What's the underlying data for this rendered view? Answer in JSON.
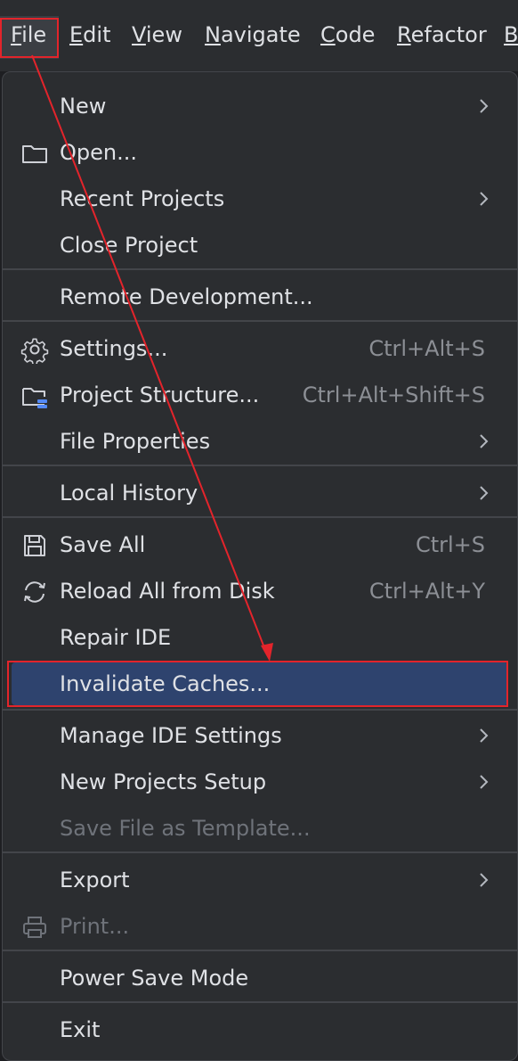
{
  "menubar": {
    "items": [
      {
        "mnemonic": "F",
        "rest": "ile"
      },
      {
        "mnemonic": "E",
        "rest": "dit"
      },
      {
        "mnemonic": "V",
        "rest": "iew"
      },
      {
        "mnemonic": "N",
        "rest": "avigate"
      },
      {
        "mnemonic": "C",
        "rest": "ode"
      },
      {
        "mnemonic": "R",
        "rest": "efactor"
      },
      {
        "mnemonic": "B",
        "rest": ""
      }
    ]
  },
  "menu": {
    "items": [
      {
        "id": "new",
        "label": "New",
        "has_submenu": true
      },
      {
        "id": "open",
        "label": "Open...",
        "icon": "folder-icon"
      },
      {
        "id": "recent-projects",
        "label": "Recent Projects",
        "has_submenu": true
      },
      {
        "id": "close-project",
        "label": "Close Project"
      },
      {
        "id": "remote-development",
        "label": "Remote Development..."
      },
      {
        "id": "settings",
        "label": "Settings...",
        "shortcut": "Ctrl+Alt+S",
        "icon": "gear-icon"
      },
      {
        "id": "project-structure",
        "label": "Project Structure...",
        "shortcut": "Ctrl+Alt+Shift+S",
        "icon": "project-structure-icon"
      },
      {
        "id": "file-properties",
        "label": "File Properties",
        "has_submenu": true
      },
      {
        "id": "local-history",
        "label": "Local History",
        "has_submenu": true
      },
      {
        "id": "save-all",
        "label": "Save All",
        "shortcut": "Ctrl+S",
        "icon": "save-icon"
      },
      {
        "id": "reload-all",
        "label": "Reload All from Disk",
        "shortcut": "Ctrl+Alt+Y",
        "icon": "reload-icon"
      },
      {
        "id": "repair-ide",
        "label": "Repair IDE"
      },
      {
        "id": "invalidate-caches",
        "label": "Invalidate Caches...",
        "highlighted": true
      },
      {
        "id": "manage-ide-settings",
        "label": "Manage IDE Settings",
        "has_submenu": true
      },
      {
        "id": "new-projects-setup",
        "label": "New Projects Setup",
        "has_submenu": true
      },
      {
        "id": "save-file-as-template",
        "label": "Save File as Template...",
        "disabled": true
      },
      {
        "id": "export",
        "label": "Export",
        "has_submenu": true
      },
      {
        "id": "print",
        "label": "Print...",
        "disabled": true,
        "icon": "printer-icon"
      },
      {
        "id": "power-save-mode",
        "label": "Power Save Mode"
      },
      {
        "id": "exit",
        "label": "Exit"
      }
    ]
  },
  "colors": {
    "menu_background": "#2b2d30",
    "highlight": "#2e436e",
    "annotation": "#e3242b",
    "text": "#dfe1e5",
    "shortcut_text": "#8c8f95",
    "disabled_text": "#6f737a"
  }
}
